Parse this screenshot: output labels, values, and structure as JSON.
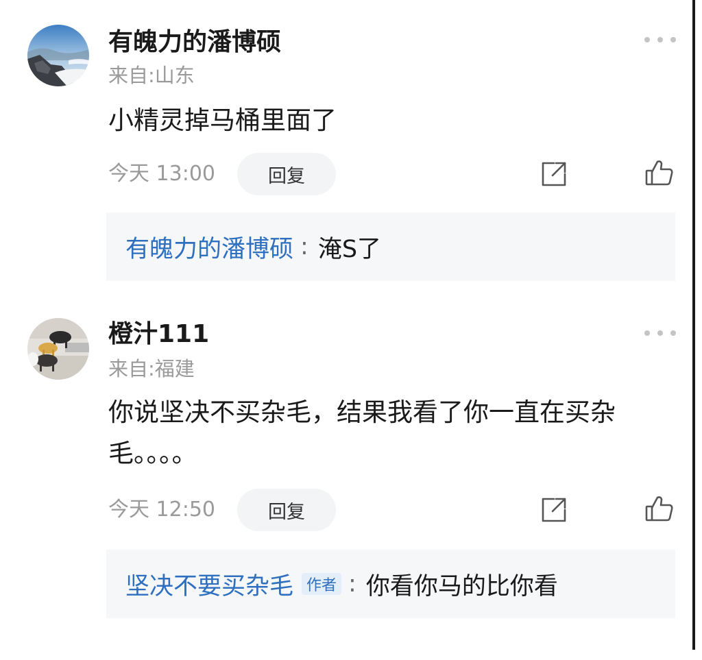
{
  "comments": [
    {
      "username": "有魄力的潘博硕",
      "location": "来自:山东",
      "content": "小精灵掉马桶里面了",
      "time": "今天 13:00",
      "reply_label": "回复",
      "reply": {
        "user": "有魄力的潘博硕",
        "separator": ":",
        "text": "淹S了"
      }
    },
    {
      "username": "橙汁111",
      "location": "来自:福建",
      "content": "你说坚决不买杂毛，结果我看了你一直在买杂毛。。。。",
      "time": "今天 12:50",
      "reply_label": "回复",
      "reply": {
        "user": "坚决不要买杂毛",
        "badge": "作者",
        "separator": ":",
        "text": "你看你马的比你看"
      }
    }
  ],
  "colors": {
    "link_blue": "#2e6fbf",
    "muted_gray": "#9a9a9a",
    "reply_bg": "#f5f7f9"
  },
  "icons": [
    "more-icon",
    "share-icon",
    "like-icon"
  ]
}
